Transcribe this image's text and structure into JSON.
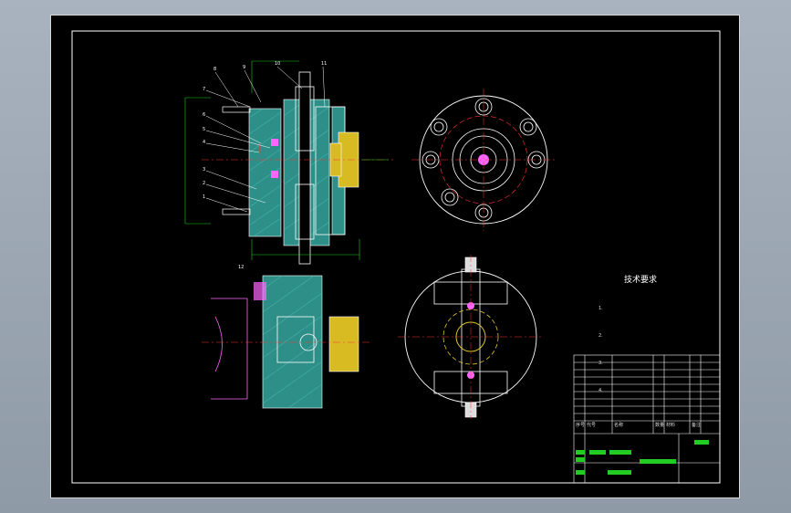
{
  "drawing": {
    "tech_req_title": "技术要求",
    "tech_req_lines": [
      "1.",
      "2.",
      "3.",
      "4."
    ],
    "title_block": {
      "drawing_name": "",
      "header_labels": [
        "序号",
        "代号",
        "名称",
        "数量",
        "材料",
        "备注"
      ]
    },
    "part_callouts": [
      "8",
      "9",
      "10",
      "11",
      "7",
      "6",
      "5",
      "4",
      "3",
      "2",
      "1",
      "12"
    ],
    "colors": {
      "background": "#000000",
      "outline": "#ffffff",
      "hatch": "#3aa39b",
      "centerline": "#ff3333",
      "dimension": "#22cc22",
      "yellow_part": "#e3c629",
      "magenta": "#ff66ff"
    }
  }
}
